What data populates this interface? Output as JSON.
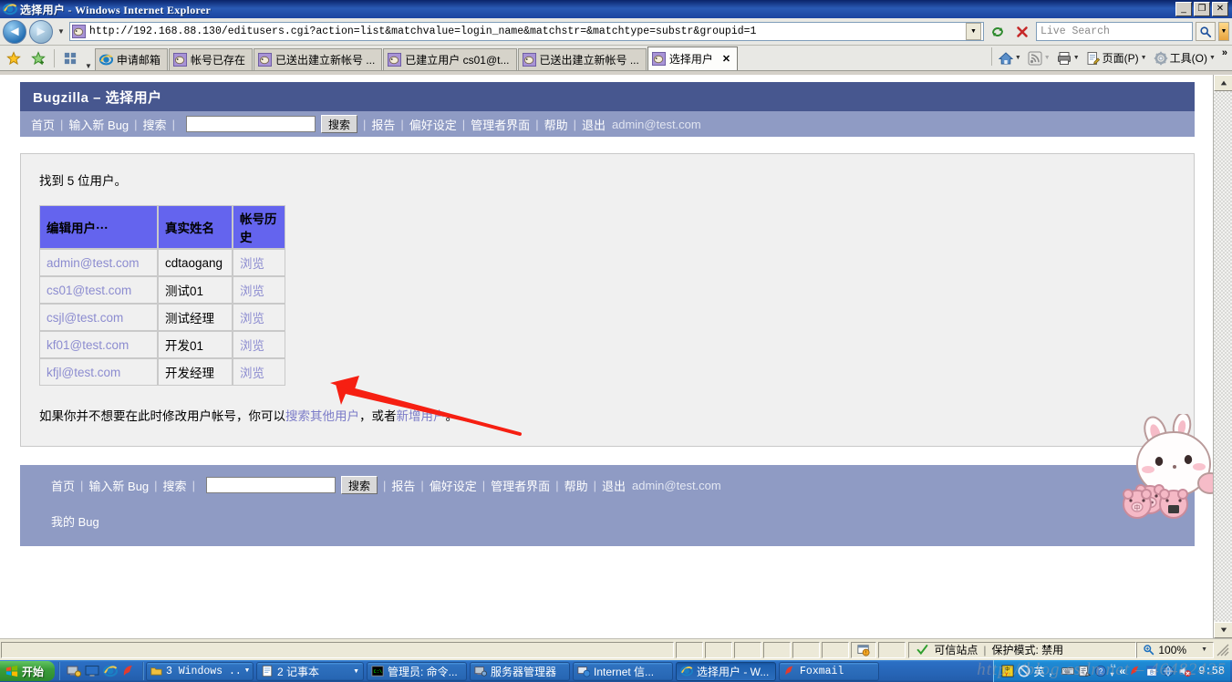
{
  "window": {
    "title": "选择用户 - Windows Internet Explorer",
    "icon": "ie-icon",
    "minimize_label": "_",
    "maximize_label": "❐",
    "close_label": "✕"
  },
  "navbar": {
    "back_label": "◄",
    "forward_label": "►",
    "history_dropdown_label": "▼",
    "url": "http://192.168.88.130/editusers.cgi?action=list&matchvalue=login_name&matchstr=&matchtype=substr&groupid=1",
    "address_dropdown_label": "▼",
    "refresh_label": "refresh-icon",
    "stop_label": "✕",
    "search_placeholder": "Live Search",
    "search_value": "",
    "search_go_label": "search-icon",
    "search_provider_label": "▼"
  },
  "tabbar": {
    "favorites_label": "★",
    "add_favorite_label": "✚",
    "quick_tabs_label": "▦",
    "tab_list_label": "▼",
    "tabs": [
      {
        "label": "申请邮箱",
        "icon": "ie-icon",
        "active": false
      },
      {
        "label": "帐号已存在",
        "icon": "page-icon",
        "active": false
      },
      {
        "label": "已送出建立新帐号 ...",
        "icon": "page-icon",
        "active": false
      },
      {
        "label": "已建立用户 cs01@t...",
        "icon": "page-icon",
        "active": false
      },
      {
        "label": "已送出建立新帐号 ...",
        "icon": "page-icon",
        "active": false
      },
      {
        "label": "选择用户",
        "icon": "page-icon",
        "active": true,
        "close_label": "✕"
      }
    ],
    "commands": [
      {
        "label": "",
        "icon": "home-icon",
        "caret": "▼"
      },
      {
        "label": "",
        "icon": "feed-icon",
        "caret": "▼"
      },
      {
        "label": "",
        "icon": "print-icon",
        "caret": "▼"
      },
      {
        "label": "页面(P)",
        "icon": "page-tools-icon",
        "caret": "▼"
      },
      {
        "label": "工具(O)",
        "icon": "gear-icon",
        "caret": "▼"
      }
    ],
    "overflow_label": "»"
  },
  "bugzilla": {
    "header_title": "Bugzilla – 选择用户",
    "nav": {
      "home": "首页",
      "new_bug": "输入新 Bug",
      "search": "搜索",
      "quicksearch_value": "",
      "search_button": "搜索",
      "reports": "报告",
      "preferences": "偏好设定",
      "administration": "管理者界面",
      "help": "帮助",
      "logout": "退出",
      "user_email": "admin@test.com",
      "separator": "|"
    },
    "content": {
      "found_text": "找到 5 位用户。",
      "table": {
        "headers": [
          "编辑用户⋯",
          "真实姓名",
          "帐号历史"
        ],
        "rows": [
          {
            "login": "admin@test.com",
            "realname": "cdtaogang",
            "history": "浏览"
          },
          {
            "login": "cs01@test.com",
            "realname": "测试01",
            "history": "浏览"
          },
          {
            "login": "csjl@test.com",
            "realname": "测试经理",
            "history": "浏览"
          },
          {
            "login": "kf01@test.com",
            "realname": "开发01",
            "history": "浏览"
          },
          {
            "login": "kfjl@test.com",
            "realname": "开发经理",
            "history": "浏览"
          }
        ]
      },
      "tail_prefix": "如果你并不想要在此时修改用户帐号，你可以",
      "tail_link1": "搜索其他用户",
      "tail_middle": "，或者",
      "tail_link2": "新增用户",
      "tail_suffix": "。"
    },
    "footer": {
      "home": "首页",
      "new_bug": "输入新 Bug",
      "search": "搜索",
      "quicksearch_value": "",
      "search_button": "搜索",
      "reports": "报告",
      "preferences": "偏好设定",
      "administration": "管理者界面",
      "help": "帮助",
      "logout": "退出",
      "user_email": "admin@test.com",
      "my_bugs": "我的 Bug",
      "separator": "|"
    }
  },
  "annotation": {
    "arrow": "red-arrow-pointing-to-user-table",
    "color": "#f61f12"
  },
  "statusbar": {
    "security_icon": "check-icon",
    "zone_text": "可信站点",
    "separator": "|",
    "protected_mode": "保护模式: 禁用",
    "zoom_icon": "zoom-icon",
    "zoom_level": "100%",
    "zoom_caret": "▼"
  },
  "taskbar": {
    "start_label": "开始",
    "quicklaunch": [
      "show-desktop-icon",
      "display-icon",
      "ie-icon",
      "foxmail-icon"
    ],
    "buttons": [
      {
        "label": "3 Windows ...",
        "icon": "folder-icon",
        "caret": "▼",
        "active": false
      },
      {
        "label": "2 记事本",
        "icon": "notepad-icon",
        "caret": "▼",
        "active": false
      },
      {
        "label": "管理员: 命令...",
        "icon": "cmd-icon",
        "active": false
      },
      {
        "label": "服务器管理器",
        "icon": "server-manager-icon",
        "active": false
      },
      {
        "label": "Internet 信...",
        "icon": "iis-icon",
        "active": false
      },
      {
        "label": "选择用户 - W...",
        "icon": "ie-icon",
        "active": true
      },
      {
        "label": "Foxmail",
        "icon": "foxmail-icon",
        "active": false
      }
    ],
    "tray": {
      "icons": [
        "ime-indicator-icon",
        "block-icon",
        "input-method-icon",
        "comma-icon",
        "keyboard-icon",
        "clipboard-icon",
        "help-icon",
        "expand-icon",
        "overflow-icon",
        "mail-icon",
        "calendar-icon",
        "network-icon",
        "volume-muted-icon"
      ],
      "ime_label": "英",
      "ime_punct": "，",
      "overflow_label": "«",
      "clock": "9:58"
    }
  },
  "watermark": {
    "text": "http://blog.csdn.net – 46482425"
  },
  "mascot": {
    "name": "white-rabbit-sticker",
    "companions": [
      "pig-sticker-1",
      "pig-sticker-2",
      "pig-sticker-3"
    ]
  }
}
